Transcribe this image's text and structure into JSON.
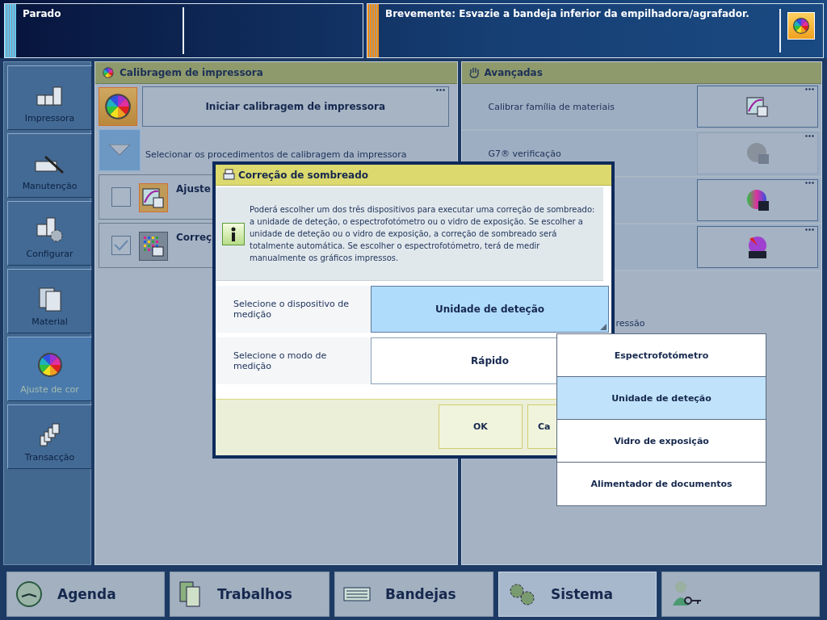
{
  "status": {
    "state": "Parado",
    "message": "Brevemente: Esvazie a bandeja inferior da empilhadora/agrafador."
  },
  "sidebar": [
    {
      "label": "Impressora",
      "kind": "printer",
      "selected": false
    },
    {
      "label": "Manutenção",
      "kind": "wrench",
      "selected": false
    },
    {
      "label": "Configurar",
      "kind": "gear",
      "selected": false
    },
    {
      "label": "Material",
      "kind": "sheets",
      "selected": false
    },
    {
      "label": "Ajuste de cor",
      "kind": "wheel",
      "selected": true
    },
    {
      "label": "Transacção",
      "kind": "stack",
      "selected": false
    }
  ],
  "calibration_panel": {
    "title": "Calibragem de impressora",
    "start_button": "Iniciar calibragem de impressora",
    "procedures_label": "Selecionar os procedimentos de calibragem da impressora",
    "procedures": [
      {
        "label": "Ajuste",
        "checked": false,
        "kind": "curve"
      },
      {
        "label": "Correç",
        "checked": true,
        "kind": "grid"
      }
    ]
  },
  "advanced_panel": {
    "title": "Avançadas",
    "items": [
      {
        "label": "Calibrar família de materiais",
        "kind": "curve",
        "disabled": false
      },
      {
        "label": "G7® verificação",
        "kind": "g7",
        "disabled": true
      },
      {
        "kind": "g7",
        "disabled": false
      },
      {
        "kind": "auto",
        "disabled": false
      }
    ],
    "partial_label": "ressão"
  },
  "dialog": {
    "title": "Correção de sombreado",
    "info": "Poderá escolher um dos três dispositivos para executar uma correção de sombreado: a unidade de deteção, o espectrofotómetro ou o vidro de exposição. Se escolher a unidade de deteção ou o vidro de exposição, a correção de sombreado será totalmente automática. Se escolher o espectrofotómetro, terá de medir manualmente os gráficos impressos.",
    "fields": [
      {
        "label": "Selecione o dispositivo de medição",
        "value": "Unidade de deteção",
        "expanded": true
      },
      {
        "label": "Selecione o modo de medição",
        "value": "Rápido",
        "expanded": false
      }
    ],
    "buttons": [
      "OK",
      "Ca"
    ]
  },
  "dropdown": {
    "options": [
      {
        "label": "Espectrofotómetro",
        "selected": false
      },
      {
        "label": "Unidade de deteção",
        "selected": true
      },
      {
        "label": "Vidro de exposição",
        "selected": false
      },
      {
        "label": "Alimentador de documentos",
        "selected": false
      }
    ]
  },
  "bottom_tabs": [
    {
      "label": "Agenda",
      "kind": "clock",
      "selected": false
    },
    {
      "label": "Trabalhos",
      "kind": "docs",
      "selected": false
    },
    {
      "label": "Bandejas",
      "kind": "tray",
      "selected": false
    },
    {
      "label": "Sistema",
      "kind": "gears",
      "selected": true
    },
    {
      "kind": "user",
      "selected": false
    }
  ]
}
